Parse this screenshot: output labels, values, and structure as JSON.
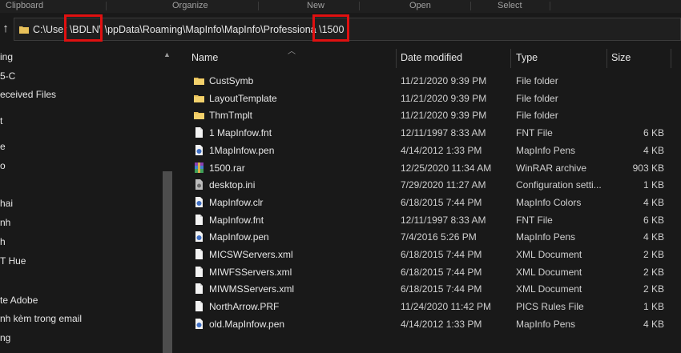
{
  "ribbon": {
    "groups": [
      "Clipboard",
      "Organize",
      "New",
      "Open",
      "Select"
    ]
  },
  "address": {
    "path": "C:\\User \\BDLN\\ \\ppData\\Roaming\\MapInfo\\MapInfo\\Professiona \\1500"
  },
  "nav": {
    "items": [
      "ing",
      "5-C",
      "eceived Files",
      "t",
      "e",
      "o",
      "hai",
      "nh",
      "h",
      "T Hue",
      "te Adobe",
      "nh kèm trong email",
      "ng"
    ]
  },
  "columns": {
    "name": "Name",
    "date": "Date modified",
    "type": "Type",
    "size": "Size"
  },
  "files": [
    {
      "name": "CustSymb",
      "date": "11/21/2020 9:39 PM",
      "type": "File folder",
      "size": "",
      "icon": "folder-icon"
    },
    {
      "name": "LayoutTemplate",
      "date": "11/21/2020 9:39 PM",
      "type": "File folder",
      "size": "",
      "icon": "folder-icon"
    },
    {
      "name": "ThmTmplt",
      "date": "11/21/2020 9:39 PM",
      "type": "File folder",
      "size": "",
      "icon": "folder-icon"
    },
    {
      "name": "1 MapInfow.fnt",
      "date": "12/11/1997 8:33 AM",
      "type": "FNT File",
      "size": "6 KB",
      "icon": "file-icon"
    },
    {
      "name": "1MapInfow.pen",
      "date": "4/14/2012 1:33 PM",
      "type": "MapInfo Pens",
      "size": "4 KB",
      "icon": "mapinfo-icon"
    },
    {
      "name": "1500.rar",
      "date": "12/25/2020 11:34 AM",
      "type": "WinRAR archive",
      "size": "903 KB",
      "icon": "winrar-icon"
    },
    {
      "name": "desktop.ini",
      "date": "7/29/2020 11:27 AM",
      "type": "Configuration setti...",
      "size": "1 KB",
      "icon": "settings-file-icon"
    },
    {
      "name": "MapInfow.clr",
      "date": "6/18/2015 7:44 PM",
      "type": "MapInfo Colors",
      "size": "4 KB",
      "icon": "mapinfo-icon"
    },
    {
      "name": "MapInfow.fnt",
      "date": "12/11/1997 8:33 AM",
      "type": "FNT File",
      "size": "6 KB",
      "icon": "file-icon"
    },
    {
      "name": "MapInfow.pen",
      "date": "7/4/2016 5:26 PM",
      "type": "MapInfo Pens",
      "size": "4 KB",
      "icon": "mapinfo-icon"
    },
    {
      "name": "MICSWServers.xml",
      "date": "6/18/2015 7:44 PM",
      "type": "XML Document",
      "size": "2 KB",
      "icon": "file-icon"
    },
    {
      "name": "MIWFSServers.xml",
      "date": "6/18/2015 7:44 PM",
      "type": "XML Document",
      "size": "2 KB",
      "icon": "file-icon"
    },
    {
      "name": "MIWMSServers.xml",
      "date": "6/18/2015 7:44 PM",
      "type": "XML Document",
      "size": "2 KB",
      "icon": "file-icon"
    },
    {
      "name": "NorthArrow.PRF",
      "date": "11/24/2020 11:42 PM",
      "type": "PICS Rules File",
      "size": "1 KB",
      "icon": "file-icon"
    },
    {
      "name": "old.MapInfow.pen",
      "date": "4/14/2012 1:33 PM",
      "type": "MapInfo Pens",
      "size": "4 KB",
      "icon": "mapinfo-icon"
    }
  ],
  "colors": {
    "background": "#191919",
    "highlight": "#e01010",
    "folder": "#e8c15a"
  }
}
